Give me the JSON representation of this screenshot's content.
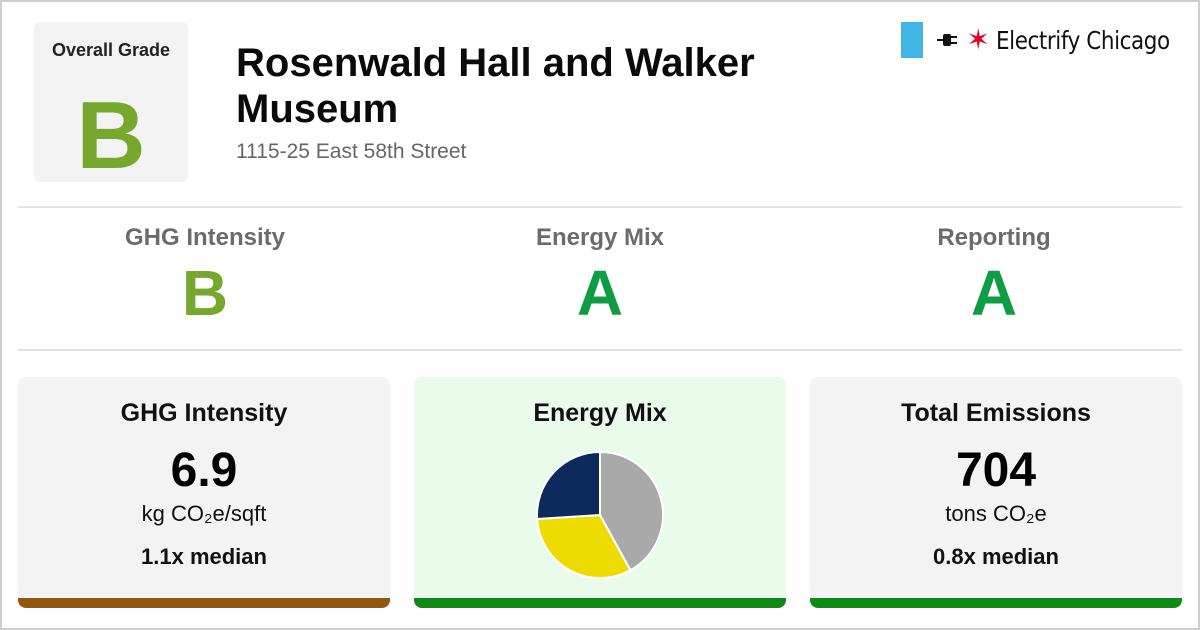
{
  "header": {
    "overall_label": "Overall Grade",
    "overall_grade": "B",
    "title": "Rosenwald Hall and Walker Museum",
    "address": "1115-25 East 58th Street",
    "brand_name": "Electrify Chicago",
    "brand_icons": [
      "chicago-flag-stripe-icon",
      "plug-icon",
      "red-star-icon"
    ]
  },
  "grades": [
    {
      "label": "GHG Intensity",
      "grade": "B"
    },
    {
      "label": "Energy Mix",
      "grade": "A"
    },
    {
      "label": "Reporting",
      "grade": "A"
    }
  ],
  "cards": {
    "ghg": {
      "title": "GHG Intensity",
      "value": "6.9",
      "unit": "kg CO₂e/sqft",
      "median": "1.1x median"
    },
    "mix": {
      "title": "Energy Mix"
    },
    "emissions": {
      "title": "Total Emissions",
      "value": "704",
      "unit": "tons CO₂e",
      "median": "0.8x median"
    }
  },
  "colors": {
    "grade_b": "#76a82e",
    "grade_a": "#0f9d44",
    "bar_ghg": "#92580f",
    "bar_mix": "#0f8a17",
    "bar_emissions": "#0f8a17",
    "mix_card_bg": "#ebfbeb",
    "card_bg": "#f3f3f3"
  },
  "chart_data": {
    "type": "pie",
    "slices": [
      {
        "value": 42,
        "color": "#a9a9a9"
      },
      {
        "value": 32,
        "color": "#eedc00"
      },
      {
        "value": 26,
        "color": "#0c2a5c"
      }
    ]
  }
}
